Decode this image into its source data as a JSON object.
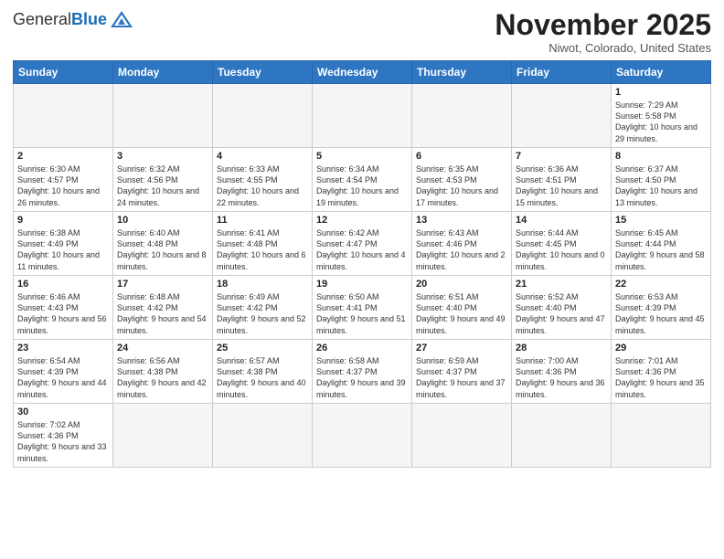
{
  "logo": {
    "general": "General",
    "blue": "Blue"
  },
  "title": "November 2025",
  "subtitle": "Niwot, Colorado, United States",
  "weekdays": [
    "Sunday",
    "Monday",
    "Tuesday",
    "Wednesday",
    "Thursday",
    "Friday",
    "Saturday"
  ],
  "weeks": [
    [
      {
        "day": "",
        "info": ""
      },
      {
        "day": "",
        "info": ""
      },
      {
        "day": "",
        "info": ""
      },
      {
        "day": "",
        "info": ""
      },
      {
        "day": "",
        "info": ""
      },
      {
        "day": "",
        "info": ""
      },
      {
        "day": "1",
        "info": "Sunrise: 7:29 AM\nSunset: 5:58 PM\nDaylight: 10 hours and 29 minutes."
      }
    ],
    [
      {
        "day": "2",
        "info": "Sunrise: 6:30 AM\nSunset: 4:57 PM\nDaylight: 10 hours and 26 minutes."
      },
      {
        "day": "3",
        "info": "Sunrise: 6:32 AM\nSunset: 4:56 PM\nDaylight: 10 hours and 24 minutes."
      },
      {
        "day": "4",
        "info": "Sunrise: 6:33 AM\nSunset: 4:55 PM\nDaylight: 10 hours and 22 minutes."
      },
      {
        "day": "5",
        "info": "Sunrise: 6:34 AM\nSunset: 4:54 PM\nDaylight: 10 hours and 19 minutes."
      },
      {
        "day": "6",
        "info": "Sunrise: 6:35 AM\nSunset: 4:53 PM\nDaylight: 10 hours and 17 minutes."
      },
      {
        "day": "7",
        "info": "Sunrise: 6:36 AM\nSunset: 4:51 PM\nDaylight: 10 hours and 15 minutes."
      },
      {
        "day": "8",
        "info": "Sunrise: 6:37 AM\nSunset: 4:50 PM\nDaylight: 10 hours and 13 minutes."
      }
    ],
    [
      {
        "day": "9",
        "info": "Sunrise: 6:38 AM\nSunset: 4:49 PM\nDaylight: 10 hours and 11 minutes."
      },
      {
        "day": "10",
        "info": "Sunrise: 6:40 AM\nSunset: 4:48 PM\nDaylight: 10 hours and 8 minutes."
      },
      {
        "day": "11",
        "info": "Sunrise: 6:41 AM\nSunset: 4:48 PM\nDaylight: 10 hours and 6 minutes."
      },
      {
        "day": "12",
        "info": "Sunrise: 6:42 AM\nSunset: 4:47 PM\nDaylight: 10 hours and 4 minutes."
      },
      {
        "day": "13",
        "info": "Sunrise: 6:43 AM\nSunset: 4:46 PM\nDaylight: 10 hours and 2 minutes."
      },
      {
        "day": "14",
        "info": "Sunrise: 6:44 AM\nSunset: 4:45 PM\nDaylight: 10 hours and 0 minutes."
      },
      {
        "day": "15",
        "info": "Sunrise: 6:45 AM\nSunset: 4:44 PM\nDaylight: 9 hours and 58 minutes."
      }
    ],
    [
      {
        "day": "16",
        "info": "Sunrise: 6:46 AM\nSunset: 4:43 PM\nDaylight: 9 hours and 56 minutes."
      },
      {
        "day": "17",
        "info": "Sunrise: 6:48 AM\nSunset: 4:42 PM\nDaylight: 9 hours and 54 minutes."
      },
      {
        "day": "18",
        "info": "Sunrise: 6:49 AM\nSunset: 4:42 PM\nDaylight: 9 hours and 52 minutes."
      },
      {
        "day": "19",
        "info": "Sunrise: 6:50 AM\nSunset: 4:41 PM\nDaylight: 9 hours and 51 minutes."
      },
      {
        "day": "20",
        "info": "Sunrise: 6:51 AM\nSunset: 4:40 PM\nDaylight: 9 hours and 49 minutes."
      },
      {
        "day": "21",
        "info": "Sunrise: 6:52 AM\nSunset: 4:40 PM\nDaylight: 9 hours and 47 minutes."
      },
      {
        "day": "22",
        "info": "Sunrise: 6:53 AM\nSunset: 4:39 PM\nDaylight: 9 hours and 45 minutes."
      }
    ],
    [
      {
        "day": "23",
        "info": "Sunrise: 6:54 AM\nSunset: 4:39 PM\nDaylight: 9 hours and 44 minutes."
      },
      {
        "day": "24",
        "info": "Sunrise: 6:56 AM\nSunset: 4:38 PM\nDaylight: 9 hours and 42 minutes."
      },
      {
        "day": "25",
        "info": "Sunrise: 6:57 AM\nSunset: 4:38 PM\nDaylight: 9 hours and 40 minutes."
      },
      {
        "day": "26",
        "info": "Sunrise: 6:58 AM\nSunset: 4:37 PM\nDaylight: 9 hours and 39 minutes."
      },
      {
        "day": "27",
        "info": "Sunrise: 6:59 AM\nSunset: 4:37 PM\nDaylight: 9 hours and 37 minutes."
      },
      {
        "day": "28",
        "info": "Sunrise: 7:00 AM\nSunset: 4:36 PM\nDaylight: 9 hours and 36 minutes."
      },
      {
        "day": "29",
        "info": "Sunrise: 7:01 AM\nSunset: 4:36 PM\nDaylight: 9 hours and 35 minutes."
      }
    ],
    [
      {
        "day": "30",
        "info": "Sunrise: 7:02 AM\nSunset: 4:36 PM\nDaylight: 9 hours and 33 minutes."
      },
      {
        "day": "",
        "info": ""
      },
      {
        "day": "",
        "info": ""
      },
      {
        "day": "",
        "info": ""
      },
      {
        "day": "",
        "info": ""
      },
      {
        "day": "",
        "info": ""
      },
      {
        "day": "",
        "info": ""
      }
    ]
  ]
}
